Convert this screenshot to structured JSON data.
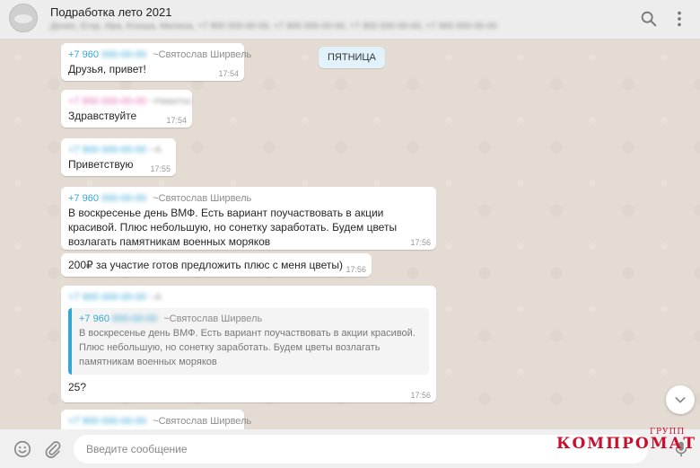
{
  "header": {
    "title": "Подработка лето 2021",
    "participants": "Денис, Егор, Ира, Ксюша, Милена, +7 900 000-00-00, +7 900 000-00-00, +7 900 000-00-00, +7 900 000-00-00"
  },
  "date_divider": "ПЯТНИЦА",
  "messages": [
    {
      "phone": "+7 960",
      "phone_hidden": "000-00-00",
      "name": "~Святослав Ширвель",
      "text": "Друзья, привет!",
      "time": "17:54"
    },
    {
      "phone_hidden": "+7 900 000-00-00",
      "name_hidden": "~Никитос",
      "text": "Здравствуйте",
      "time": "17:54"
    },
    {
      "phone_hidden": "+7 900 000-00-00",
      "name_hidden": "~А",
      "text": "Приветствую",
      "time": "17:55"
    },
    {
      "phone": "+7 960",
      "phone_hidden": "000-00-00",
      "name": "~Святослав Ширвель",
      "text": "В воскресенье день ВМФ. Есть вариант поучаствовать в акции красивой. Плюс небольшую, но сонетку заработать. Будем цветы возлагать памятникам военных моряков",
      "time": "17:56"
    },
    {
      "text": "200₽ за участие готов предложить плюс с меня цветы)",
      "time": "17:56"
    },
    {
      "phone_hidden": "+7 900 000-00-00",
      "name_hidden": "~А",
      "quote": {
        "phone": "+7 960",
        "phone_hidden": "000-00-00",
        "name": "~Святослав Ширвель",
        "text": "В воскресенье день ВМФ. Есть вариант поучаствовать в акции красивой. Плюс небольшую, но сонетку заработать. Будем цветы возлагать памятникам военных моряков"
      },
      "text": "25?",
      "time": "17:56"
    },
    {
      "phone_hidden": "+7 900 000-00-00",
      "name": "~Святослав Ширвель"
    }
  ],
  "composer": {
    "placeholder": "Введите сообщение"
  },
  "watermark": {
    "main": "КОМПРОМАТ",
    "small": "ГРУПП"
  },
  "icons": {
    "search": "search-icon",
    "menu": "kebab-menu-icon",
    "emoji": "emoji-icon",
    "attach": "paperclip-icon",
    "mic": "microphone-icon",
    "scroll": "chevron-down-icon"
  },
  "colors": {
    "phone": "#35a7d3",
    "watermark": "#c8102e",
    "date_pill": "#e1f2fb"
  }
}
